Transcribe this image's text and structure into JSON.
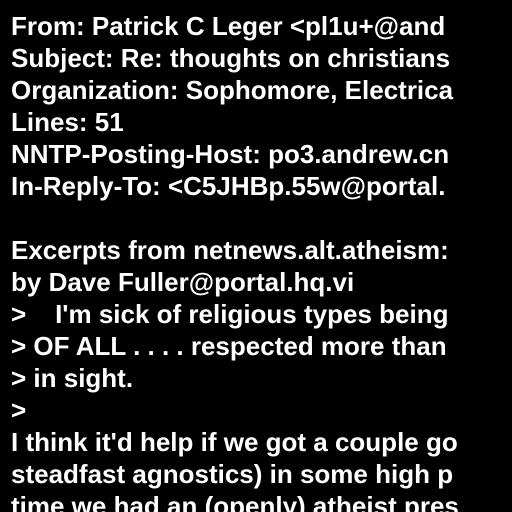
{
  "colors": {
    "background": "#000000",
    "text": "#ffffff"
  },
  "headers": {
    "from": "From: Patrick C Leger <pl1u+@and",
    "subject": "Subject: Re: thoughts on christians",
    "organization": "Organization: Sophomore, Electrica",
    "lines": "Lines: 51",
    "nntp_posting_host": "NNTP-Posting-Host: po3.andrew.cn",
    "in_reply_to": "In-Reply-To: <C5JHBp.55w@portal."
  },
  "body": {
    "blank": "",
    "excerpt_intro": "Excerpts from netnews.alt.atheism:",
    "attribution": "by Dave Fuller@portal.hq.vi",
    "quote_1": ">    I'm sick of religious types being",
    "quote_2": "> OF ALL . . . . respected more than",
    "quote_3": "> in sight.",
    "quote_4": ">",
    "reply_1": "I think it'd help if we got a couple go",
    "reply_2": "steadfast agnostics) in some high p",
    "reply_3": "time we had an (openly) atheist pres"
  }
}
